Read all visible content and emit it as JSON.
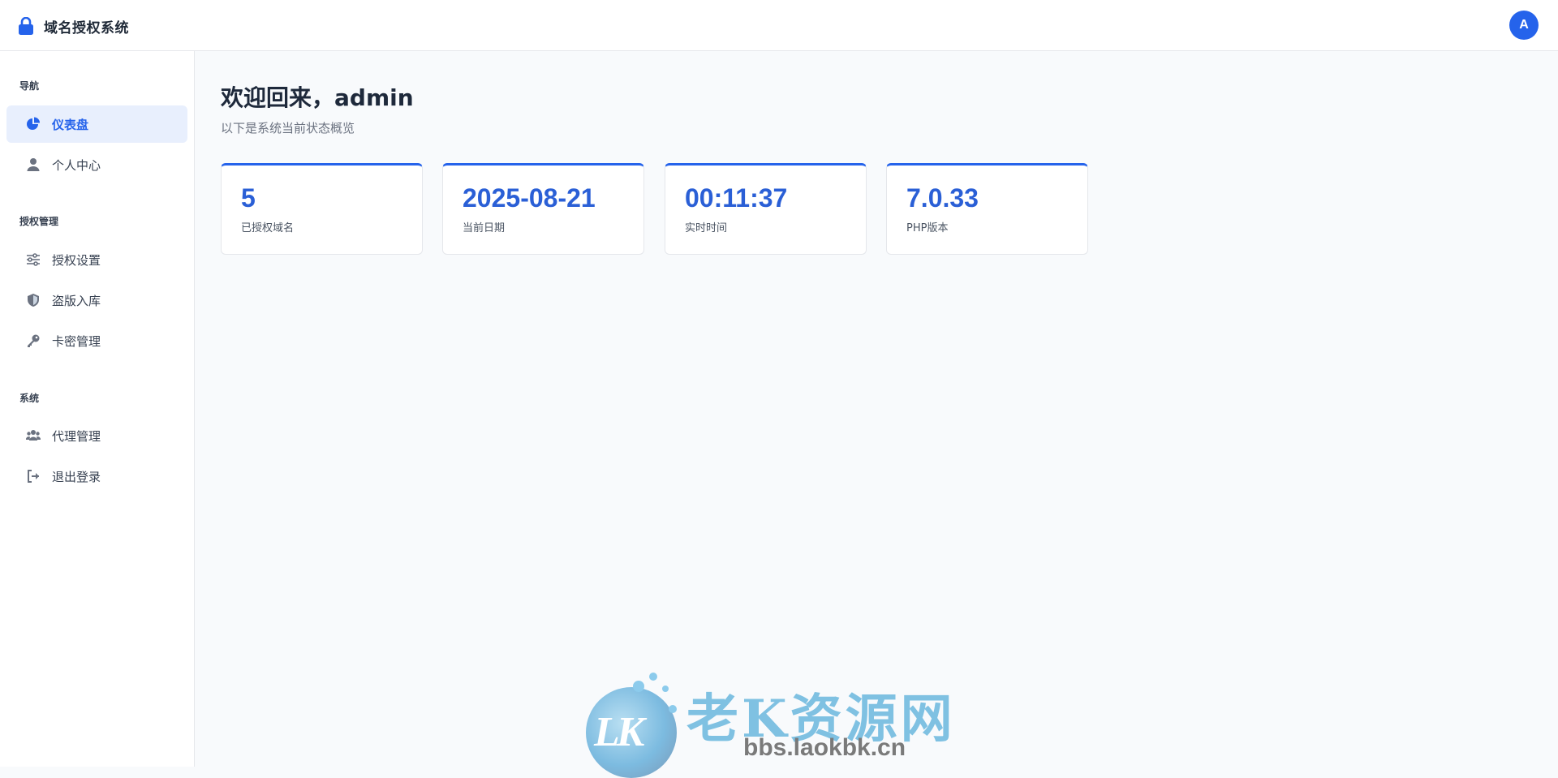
{
  "header": {
    "title": "域名授权系统",
    "avatar_letter": "A",
    "accent_color": "#2563eb"
  },
  "sidebar": {
    "sections": [
      {
        "label": "导航"
      },
      {
        "label": "授权管理"
      },
      {
        "label": "系统"
      }
    ],
    "items": [
      {
        "label": "仪表盘",
        "icon": "pie-chart-icon",
        "active": true
      },
      {
        "label": "个人中心",
        "icon": "user-icon"
      },
      {
        "label": "授权设置",
        "icon": "sliders-icon"
      },
      {
        "label": "盗版入库",
        "icon": "shield-icon"
      },
      {
        "label": "卡密管理",
        "icon": "key-icon"
      },
      {
        "label": "代理管理",
        "icon": "users-icon"
      },
      {
        "label": "退出登录",
        "icon": "logout-icon"
      }
    ]
  },
  "main": {
    "welcome": "欢迎回来，admin",
    "subtitle": "以下是系统当前状态概览",
    "stats": [
      {
        "value": "5",
        "label": "已授权域名"
      },
      {
        "value": "2025-08-21",
        "label": "当前日期"
      },
      {
        "value": "00:11:37",
        "label": "实时时间"
      },
      {
        "value": "7.0.33",
        "label": "PHP版本"
      }
    ]
  },
  "watermark": {
    "logo_text": "LK",
    "site_name": "老K资源网",
    "url": "bbs.laokbk.cn"
  }
}
